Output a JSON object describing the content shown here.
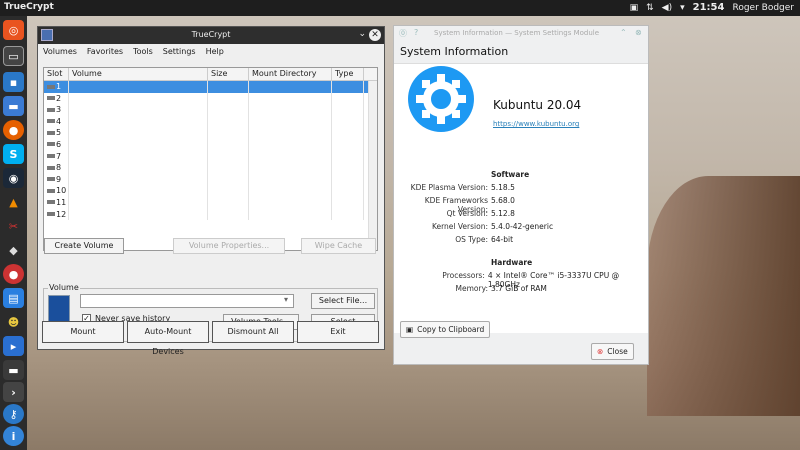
{
  "topbar": {
    "app_name": "TrueCrypt",
    "clock": "21:54",
    "user": "Roger Bodger"
  },
  "truecrypt": {
    "title": "TrueCrypt",
    "menu": [
      "Volumes",
      "Favorites",
      "Tools",
      "Settings",
      "Help"
    ],
    "columns": [
      "Slot",
      "Volume",
      "Size",
      "Mount Directory",
      "Type"
    ],
    "slots": [
      "1",
      "2",
      "3",
      "4",
      "5",
      "6",
      "7",
      "8",
      "9",
      "10",
      "11",
      "12"
    ],
    "buttons": {
      "create_volume": "Create Volume",
      "volume_properties": "Volume Properties...",
      "wipe_cache": "Wipe Cache",
      "select_file": "Select File...",
      "volume_tools": "Volume Tools...",
      "select_device": "Select Device...",
      "mount": "Mount",
      "auto_mount": "Auto-Mount Devices",
      "dismount_all": "Dismount All",
      "exit": "Exit"
    },
    "volume_group_label": "Volume",
    "volume_path": "",
    "never_save_history": "Never save history",
    "never_save_checked": true
  },
  "sysinfo": {
    "title": "System Information — System Settings Module",
    "heading": "System Information",
    "os_name": "Kubuntu 20.04",
    "url": "https://www.kubuntu.org",
    "software_heading": "Software",
    "software": [
      {
        "k": "KDE Plasma Version:",
        "v": "5.18.5"
      },
      {
        "k": "KDE Frameworks Version:",
        "v": "5.68.0"
      },
      {
        "k": "Qt Version:",
        "v": "5.12.8"
      },
      {
        "k": "Kernel Version:",
        "v": "5.4.0-42-generic"
      },
      {
        "k": "OS Type:",
        "v": "64-bit"
      }
    ],
    "hardware_heading": "Hardware",
    "hardware": [
      {
        "k": "Processors:",
        "v": "4 × Intel® Core™ i5-3337U CPU @ 1.80GHz"
      },
      {
        "k": "Memory:",
        "v": "3.7 GiB of RAM"
      }
    ],
    "copy_button": "Copy to Clipboard",
    "close_button": "Close"
  },
  "dock": [
    "ubuntu-icon",
    "desktop-icon",
    "terminal-icon",
    "files-icon",
    "firefox-icon",
    "skype-icon",
    "steam-icon",
    "vlc-icon",
    "tool-icon",
    "budgie-icon",
    "docs-icon",
    "gimp-icon",
    "remote-icon",
    "bar-icon",
    "next-icon",
    "truecrypt-icon",
    "info-icon"
  ]
}
